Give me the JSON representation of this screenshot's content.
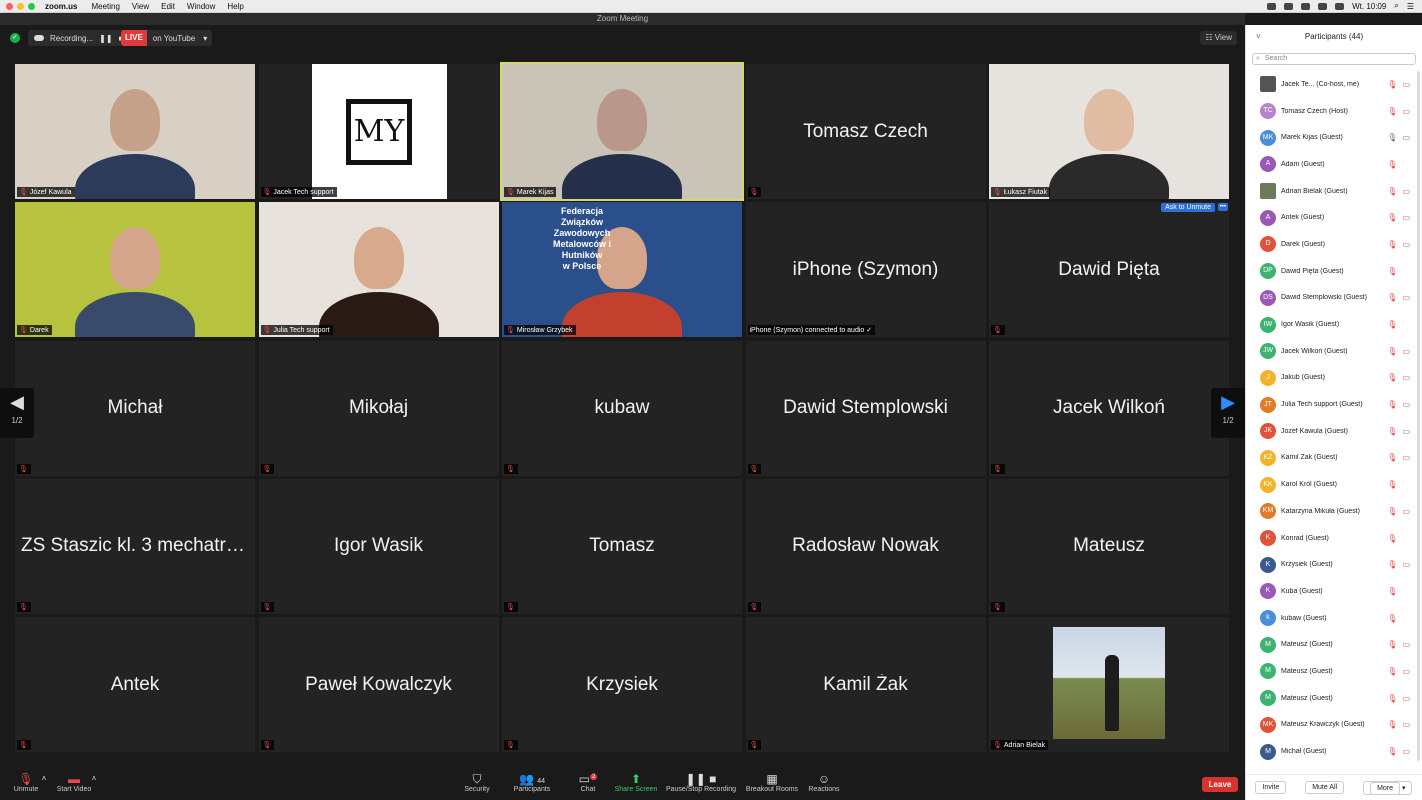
{
  "menubar": {
    "app": "zoom.us",
    "menus": [
      "Meeting",
      "View",
      "Edit",
      "Window",
      "Help"
    ],
    "clock": "Wt. 10:09"
  },
  "window_title": "Zoom Meeting",
  "topbar": {
    "recording": "Recording...",
    "live_badge": "LIVE",
    "live_target": "on YouTube",
    "view": "View"
  },
  "tiles": [
    {
      "name": "Józef Kawula",
      "video": true
    },
    {
      "name": "Jacek Tech support",
      "video": true,
      "logo": "MY"
    },
    {
      "name": "Marek Kijas",
      "video": true,
      "active": true
    },
    {
      "name": "Tomasz Czech",
      "video": false
    },
    {
      "name": "Łukasz Fiutak",
      "video": true
    },
    {
      "name": "Darek",
      "video": true
    },
    {
      "name": "Julia Tech support",
      "video": true
    },
    {
      "name": "Mirosław Grzybek",
      "video": true,
      "banner": [
        "Federacja",
        "Związków",
        "Zawodowych",
        "Metalowców i Hutników",
        "w Polsce"
      ]
    },
    {
      "name": "iPhone (Szymon)",
      "video": false,
      "status": "iPhone (Szymon) connected to audio"
    },
    {
      "name": "Dawid Pięta",
      "video": false,
      "ask": "Ask to Unmute"
    },
    {
      "name": "Michał",
      "video": false
    },
    {
      "name": "Mikołaj",
      "video": false
    },
    {
      "name": "kubaw",
      "video": false
    },
    {
      "name": "Dawid Stemplowski",
      "video": false
    },
    {
      "name": "Jacek Wilkoń",
      "video": false
    },
    {
      "name": "ZS Staszic kl. 3 mechatro...",
      "video": false
    },
    {
      "name": "Igor Wasik",
      "video": false
    },
    {
      "name": "Tomasz",
      "video": false
    },
    {
      "name": "Radosław Nowak",
      "video": false
    },
    {
      "name": "Mateusz",
      "video": false
    },
    {
      "name": "Antek",
      "video": false
    },
    {
      "name": "Paweł Kowalczyk",
      "video": false
    },
    {
      "name": "Krzysiek",
      "video": false
    },
    {
      "name": "Kamil Żak",
      "video": false
    },
    {
      "name": "Adrian Bielak",
      "video": true,
      "photo": true
    }
  ],
  "pager": "1/2",
  "bottombar": {
    "unmute": "Unmute",
    "start_video": "Start Video",
    "security": "Security",
    "participants": "Participants",
    "participants_count": "44",
    "chat": "Chat",
    "chat_badge": "2",
    "share": "Share Screen",
    "record": "Pause/Stop Recording",
    "breakout": "Breakout Rooms",
    "reactions": "Reactions",
    "leave": "Leave"
  },
  "panel": {
    "title": "Participants (44)",
    "search_placeholder": "Search",
    "invite": "Invite",
    "mute_all": "Mute All",
    "more": "More",
    "participants": [
      {
        "initials": "",
        "name": "Jacek Te... (Co-host, me)",
        "color": "#555555",
        "mic": "off",
        "cam": "off"
      },
      {
        "initials": "TC",
        "name": "Tomasz Czech (Host)",
        "color": "#b583c9",
        "mic": "off",
        "cam": "off"
      },
      {
        "initials": "MK",
        "name": "Marek Kijas (Guest)",
        "color": "#4b8fd8",
        "mic": "on",
        "cam": "on"
      },
      {
        "initials": "A",
        "name": "Adam (Guest)",
        "color": "#9b59b6",
        "mic": "off",
        "cam": ""
      },
      {
        "initials": "",
        "name": "Adrian Bielak (Guest)",
        "color": "#6b7b5a",
        "mic": "off",
        "cam": "off"
      },
      {
        "initials": "A",
        "name": "Antek (Guest)",
        "color": "#9b59b6",
        "mic": "off",
        "cam": "off"
      },
      {
        "initials": "D",
        "name": "Darek (Guest)",
        "color": "#e0533a",
        "mic": "off",
        "cam": "on"
      },
      {
        "initials": "DP",
        "name": "Dawid Pięta (Guest)",
        "color": "#3cb371",
        "mic": "off",
        "cam": ""
      },
      {
        "initials": "DS",
        "name": "Dawid Stemplowski (Guest)",
        "color": "#9b59b6",
        "mic": "off",
        "cam": "off"
      },
      {
        "initials": "IW",
        "name": "Igor Wasik (Guest)",
        "color": "#3cb371",
        "mic": "off",
        "cam": ""
      },
      {
        "initials": "JW",
        "name": "Jacek Wilkoń (Guest)",
        "color": "#3cb371",
        "mic": "off",
        "cam": "off"
      },
      {
        "initials": "J",
        "name": "Jakub (Guest)",
        "color": "#f1b32b",
        "mic": "off",
        "cam": "off"
      },
      {
        "initials": "JT",
        "name": "Julia Tech support (Guest)",
        "color": "#e07b2a",
        "mic": "off",
        "cam": "on"
      },
      {
        "initials": "JK",
        "name": "Józef Kawula (Guest)",
        "color": "#e0533a",
        "mic": "off",
        "cam": "on"
      },
      {
        "initials": "KŻ",
        "name": "Kamil Żak (Guest)",
        "color": "#f1b32b",
        "mic": "off",
        "cam": "off"
      },
      {
        "initials": "KK",
        "name": "Karol Król (Guest)",
        "color": "#f1b32b",
        "mic": "off",
        "cam": ""
      },
      {
        "initials": "KM",
        "name": "Katarzyna Mikuła (Guest)",
        "color": "#e07b2a",
        "mic": "off",
        "cam": "off"
      },
      {
        "initials": "K",
        "name": "Konrad (Guest)",
        "color": "#e0533a",
        "mic": "off",
        "cam": ""
      },
      {
        "initials": "K",
        "name": "Krzysiek (Guest)",
        "color": "#3c5a8c",
        "mic": "off",
        "cam": "off"
      },
      {
        "initials": "K",
        "name": "Kuba (Guest)",
        "color": "#9b59b6",
        "mic": "off",
        "cam": ""
      },
      {
        "initials": "k",
        "name": "kubaw (Guest)",
        "color": "#4b8fd8",
        "mic": "off",
        "cam": ""
      },
      {
        "initials": "M",
        "name": "Mateusz (Guest)",
        "color": "#3cb371",
        "mic": "off",
        "cam": "off"
      },
      {
        "initials": "M",
        "name": "Mateusz (Guest)",
        "color": "#3cb371",
        "mic": "off",
        "cam": "off"
      },
      {
        "initials": "M",
        "name": "Mateusz (Guest)",
        "color": "#3cb371",
        "mic": "off",
        "cam": "off"
      },
      {
        "initials": "MK",
        "name": "Mateusz Krawczyk (Guest)",
        "color": "#e0533a",
        "mic": "off",
        "cam": "off"
      },
      {
        "initials": "M",
        "name": "Michał (Guest)",
        "color": "#3c5a8c",
        "mic": "off",
        "cam": "off"
      }
    ]
  }
}
